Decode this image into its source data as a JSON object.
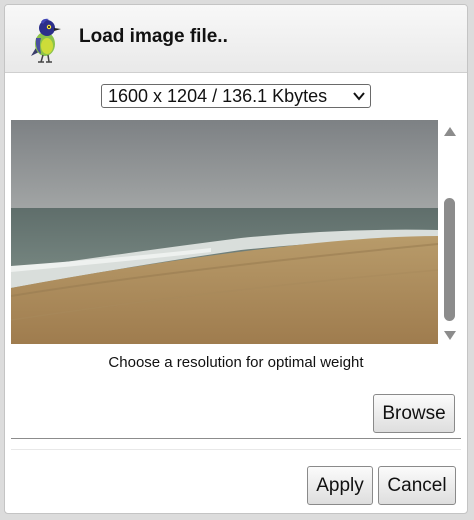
{
  "dialog": {
    "title": "Load image file..",
    "logo_icon": "green-jay-bird-icon"
  },
  "resolution_select": {
    "selected": "1600 x 1204 / 136.1 Kbytes",
    "icon": "chevron-down-icon"
  },
  "preview": {
    "icon": "beach-photo",
    "scrollbar": {
      "up_icon": "scroll-up-arrow-icon",
      "down_icon": "scroll-down-arrow-icon"
    }
  },
  "hint": "Choose a resolution for optimal weight",
  "buttons": {
    "browse": "Browse",
    "apply": "Apply",
    "cancel": "Cancel"
  },
  "colors": {
    "sky": "#8c9092",
    "sea": "#607a78",
    "sand": "#b08e5e",
    "bird_body": "#8bc34a",
    "bird_head": "#2c2f8a"
  }
}
